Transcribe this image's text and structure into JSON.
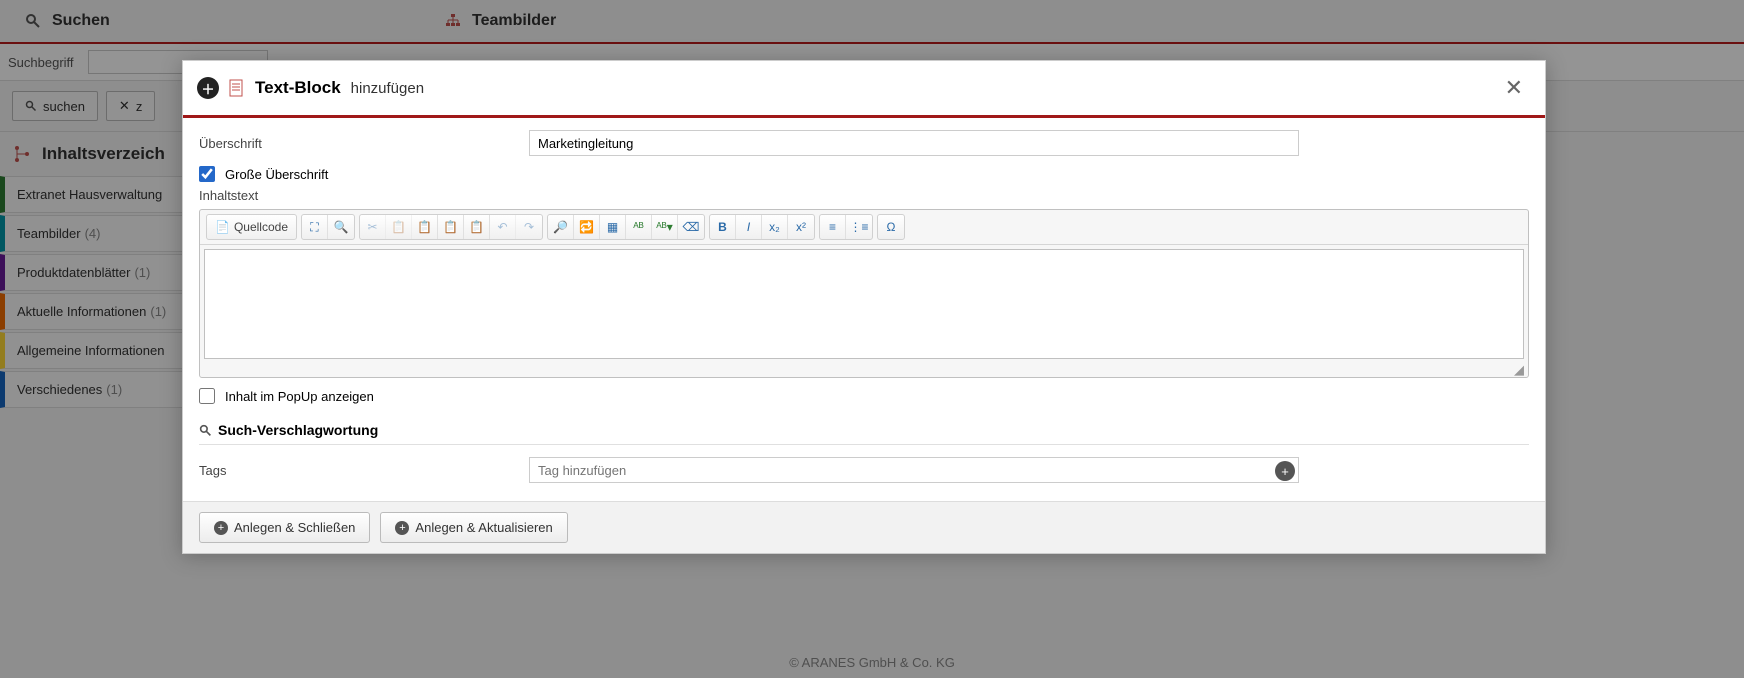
{
  "topTabs": {
    "search": "Suchen",
    "team": "Teambilder"
  },
  "search": {
    "label": "Suchbegriff",
    "value": "",
    "searchBtn": "suchen",
    "resetBtn": "z"
  },
  "sidebar": {
    "title": "Inhaltsverzeich",
    "items": [
      {
        "label": "Extranet Hausverwaltung",
        "count": "",
        "color": "#2e7d32"
      },
      {
        "label": "Teambilder",
        "count": "(4)",
        "color": "#0097a7"
      },
      {
        "label": "Produktdatenblätter",
        "count": "(1)",
        "color": "#6a1b9a"
      },
      {
        "label": "Aktuelle Informationen",
        "count": "(1)",
        "color": "#ef6c00"
      },
      {
        "label": "Allgemeine Informationen",
        "count": "",
        "color": "#fdd835"
      },
      {
        "label": "Verschiedenes",
        "count": "(1)",
        "color": "#1565c0"
      }
    ]
  },
  "modal": {
    "titleMain": "Text-Block",
    "titleSub": "hinzufügen",
    "labels": {
      "headline": "Überschrift",
      "bigHeadline": "Große Überschrift",
      "contentText": "Inhaltstext",
      "showInPopup": "Inhalt im PopUp anzeigen",
      "tagging": "Such-Verschlagwortung",
      "tags": "Tags"
    },
    "fields": {
      "headline": "Marketingleitung",
      "bigHeadlineChecked": true,
      "showInPopupChecked": false,
      "tagPlaceholder": "Tag hinzufügen"
    },
    "editor": {
      "sourceBtn": "Quellcode"
    },
    "buttons": {
      "createClose": "Anlegen & Schließen",
      "createUpdate": "Anlegen & Aktualisieren"
    }
  },
  "footer": "© ARANES GmbH & Co. KG"
}
